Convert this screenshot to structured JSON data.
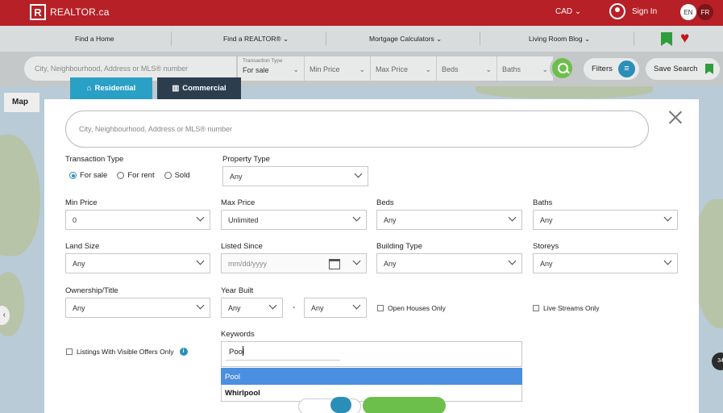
{
  "header": {
    "logo_mark": "R",
    "logo_text": "REALTOR.ca",
    "currency": "CAD",
    "currency_chevron": "⌄",
    "signin": "Sign In",
    "lang_en": "EN",
    "lang_fr": "FR"
  },
  "nav": {
    "items": [
      "Find a Home",
      "Find a REALTOR®",
      "Mortgage Calculators",
      "Living Room Blog"
    ],
    "chevron": "⌄"
  },
  "searchbar": {
    "placeholder": "City, Neighbourhood, Address or MLS® number",
    "transaction_label": "Transaction Type",
    "transaction_value": "For sale",
    "min_price": "Min Price",
    "max_price": "Max Price",
    "beds": "Beds",
    "baths": "Baths",
    "chevron": "⌄",
    "filters": "Filters",
    "filters_icon": "≡",
    "save_search": "Save Search"
  },
  "map": {
    "tab": "Map",
    "pin_count": "34",
    "arrow": "‹"
  },
  "tabs": {
    "residential": "Residential",
    "residential_icon": "⌂",
    "commercial": "Commercial",
    "commercial_icon": "▥"
  },
  "modal": {
    "search_placeholder": "City, Neighbourhood, Address or MLS® number",
    "transaction_type_label": "Transaction Type",
    "transaction_options": [
      "For sale",
      "For rent",
      "Sold"
    ],
    "transaction_selected": 0,
    "property_type_label": "Property Type",
    "property_type_value": "Any",
    "min_price_label": "Min Price",
    "min_price_value": "0",
    "max_price_label": "Max Price",
    "max_price_value": "Unlimited",
    "beds_label": "Beds",
    "beds_value": "Any",
    "baths_label": "Baths",
    "baths_value": "Any",
    "land_size_label": "Land Size",
    "land_size_value": "Any",
    "listed_since_label": "Listed Since",
    "listed_since_placeholder": "mm/dd/yyyy",
    "building_type_label": "Building Type",
    "building_type_value": "Any",
    "storeys_label": "Storeys",
    "storeys_value": "Any",
    "ownership_label": "Ownership/Title",
    "ownership_value": "Any",
    "year_built_label": "Year Built",
    "year_built_from": "Any",
    "year_built_to": "Any",
    "year_dash": "-",
    "open_houses": "Open Houses Only",
    "live_streams": "Live Streams Only",
    "visible_offers": "Listings With Visible Offers Only",
    "info_icon": "i",
    "keywords_label": "Keywords",
    "keywords_value": "Pool",
    "suggestions": [
      "Pool",
      "Whirlpool"
    ]
  },
  "colors": {
    "brand_red": "#b62026",
    "accent_blue": "#2a8fb8",
    "accent_green": "#6dbf4b",
    "highlight": "#4a8fe0"
  }
}
